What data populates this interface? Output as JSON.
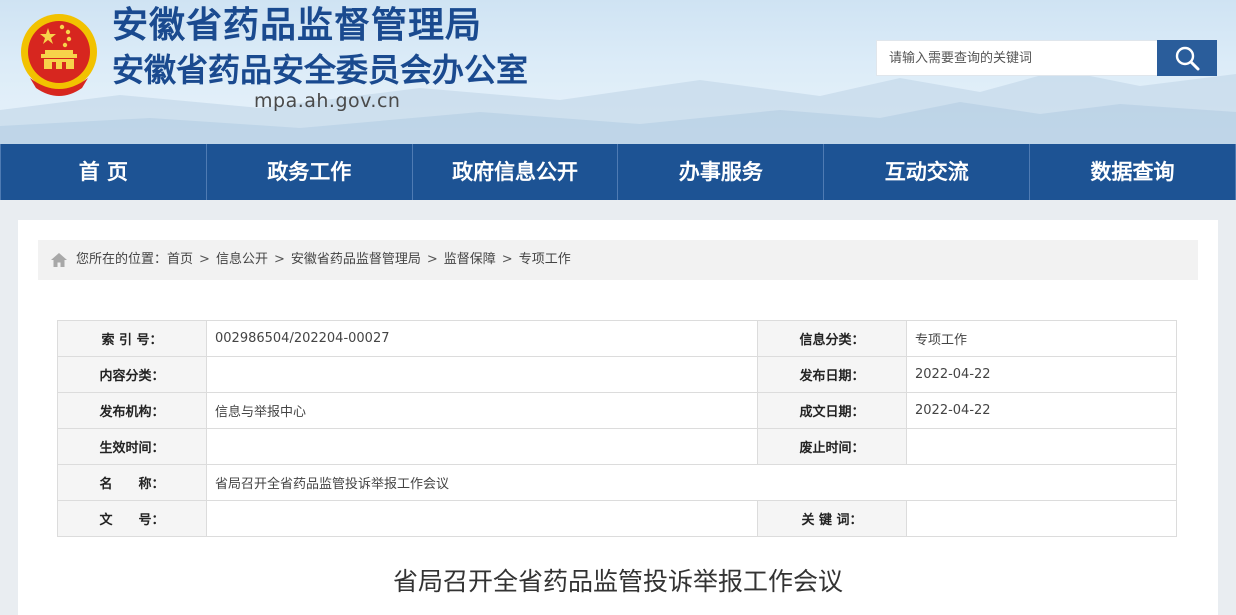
{
  "header": {
    "title": "安徽省药品监督管理局",
    "subtitle": "安徽省药品安全委员会办公室",
    "domain": "mpa.ah.gov.cn"
  },
  "search": {
    "placeholder": "请输入需要查询的关键词"
  },
  "nav": {
    "items": [
      "首 页",
      "政务工作",
      "政府信息公开",
      "办事服务",
      "互动交流",
      "数据查询"
    ]
  },
  "breadcrumb": {
    "prefix": "您所在的位置：",
    "items": [
      "首页",
      "信息公开",
      "安徽省药品监督管理局",
      "监督保障",
      "专项工作"
    ],
    "separator": ">"
  },
  "info": {
    "rows": [
      {
        "l1": "索 引 号：",
        "v1": "002986504/202204-00027",
        "l2": "信息分类：",
        "v2": "专项工作"
      },
      {
        "l1": "内容分类：",
        "v1": "",
        "l2": "发布日期：",
        "v2": "2022-04-22"
      },
      {
        "l1": "发布机构：",
        "v1": "信息与举报中心",
        "l2": "成文日期：",
        "v2": "2022-04-22"
      },
      {
        "l1": "生效时间：",
        "v1": "",
        "l2": "废止时间：",
        "v2": ""
      },
      {
        "l1": "名　　称：",
        "v1": "省局召开全省药品监管投诉举报工作会议"
      },
      {
        "l1": "文　　号：",
        "v1": "",
        "l2": "关 键 词：",
        "v2": ""
      }
    ]
  },
  "article": {
    "title": "省局召开全省药品监管投诉举报工作会议"
  },
  "icons": {
    "emblem": "national-emblem-icon",
    "search": "search-icon",
    "home": "home-icon"
  },
  "colors": {
    "brand": "#1a4a8f",
    "nav_bg": "#1d5394",
    "search_btn": "#2a5d9b"
  }
}
